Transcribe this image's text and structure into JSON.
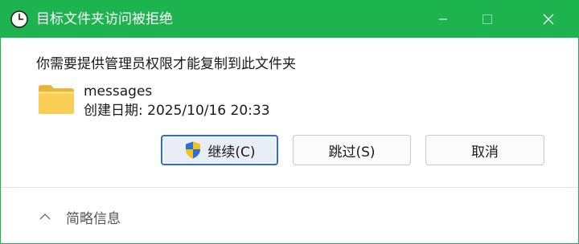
{
  "window": {
    "title": "目标文件夹访问被拒绝",
    "title_icon": "clock-icon",
    "accent_color": "#1db34f",
    "controls": [
      "minimize-icon",
      "maximize-icon",
      "close-icon"
    ]
  },
  "main": {
    "message": "你需要提供管理员权限才能复制到此文件夹",
    "file": {
      "icon": "folder-icon",
      "name": "messages",
      "date_label": "创建日期: 2025/10/16 20:33"
    }
  },
  "buttons": {
    "continue_label": "继续(C)",
    "continue_icon": "uac-shield-icon",
    "skip_label": "跳过(S)",
    "cancel_label": "取消"
  },
  "details": {
    "label": "简略信息",
    "icon": "chevron-up-icon"
  }
}
